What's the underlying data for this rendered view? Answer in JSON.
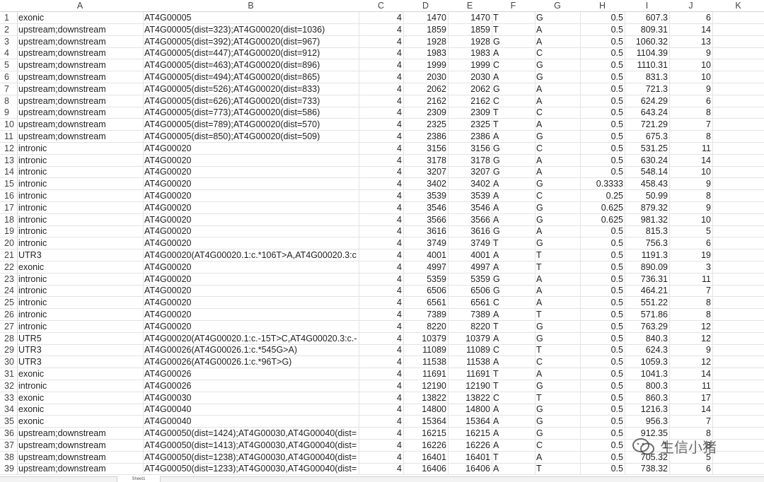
{
  "columns": [
    "A",
    "B",
    "C",
    "D",
    "E",
    "F",
    "G",
    "H",
    "I",
    "J",
    "K"
  ],
  "rows": [
    [
      "1",
      "exonic",
      "AT4G00005",
      "4",
      "1470",
      "1470",
      "T",
      "G",
      "0.5",
      "607.3",
      "6"
    ],
    [
      "2",
      "upstream;downstream",
      "AT4G00005(dist=323);AT4G00020(dist=1036)",
      "4",
      "1859",
      "1859",
      "T",
      "A",
      "0.5",
      "809.31",
      "14"
    ],
    [
      "3",
      "upstream;downstream",
      "AT4G00005(dist=392);AT4G00020(dist=967)",
      "4",
      "1928",
      "1928",
      "G",
      "A",
      "0.5",
      "1060.32",
      "13"
    ],
    [
      "4",
      "upstream;downstream",
      "AT4G00005(dist=447);AT4G00020(dist=912)",
      "4",
      "1983",
      "1983",
      "A",
      "C",
      "0.5",
      "1104.39",
      "9"
    ],
    [
      "5",
      "upstream;downstream",
      "AT4G00005(dist=463);AT4G00020(dist=896)",
      "4",
      "1999",
      "1999",
      "C",
      "G",
      "0.5",
      "1110.31",
      "10"
    ],
    [
      "6",
      "upstream;downstream",
      "AT4G00005(dist=494);AT4G00020(dist=865)",
      "4",
      "2030",
      "2030",
      "A",
      "G",
      "0.5",
      "831.3",
      "10"
    ],
    [
      "7",
      "upstream;downstream",
      "AT4G00005(dist=526);AT4G00020(dist=833)",
      "4",
      "2062",
      "2062",
      "G",
      "A",
      "0.5",
      "721.3",
      "9"
    ],
    [
      "8",
      "upstream;downstream",
      "AT4G00005(dist=626);AT4G00020(dist=733)",
      "4",
      "2162",
      "2162",
      "C",
      "A",
      "0.5",
      "624.29",
      "6"
    ],
    [
      "9",
      "upstream;downstream",
      "AT4G00005(dist=773);AT4G00020(dist=586)",
      "4",
      "2309",
      "2309",
      "T",
      "C",
      "0.5",
      "643.24",
      "8"
    ],
    [
      "10",
      "upstream;downstream",
      "AT4G00005(dist=789);AT4G00020(dist=570)",
      "4",
      "2325",
      "2325",
      "T",
      "A",
      "0.5",
      "721.29",
      "7"
    ],
    [
      "11",
      "upstream;downstream",
      "AT4G00005(dist=850);AT4G00020(dist=509)",
      "4",
      "2386",
      "2386",
      "A",
      "G",
      "0.5",
      "675.3",
      "8"
    ],
    [
      "12",
      "intronic",
      "AT4G00020",
      "4",
      "3156",
      "3156",
      "G",
      "C",
      "0.5",
      "531.25",
      "11"
    ],
    [
      "13",
      "intronic",
      "AT4G00020",
      "4",
      "3178",
      "3178",
      "G",
      "A",
      "0.5",
      "630.24",
      "14"
    ],
    [
      "14",
      "intronic",
      "AT4G00020",
      "4",
      "3207",
      "3207",
      "G",
      "A",
      "0.5",
      "548.14",
      "10"
    ],
    [
      "15",
      "intronic",
      "AT4G00020",
      "4",
      "3402",
      "3402",
      "A",
      "G",
      "0.3333",
      "458.43",
      "9"
    ],
    [
      "16",
      "intronic",
      "AT4G00020",
      "4",
      "3539",
      "3539",
      "A",
      "C",
      "0.25",
      "50.99",
      "8"
    ],
    [
      "17",
      "intronic",
      "AT4G00020",
      "4",
      "3546",
      "3546",
      "A",
      "G",
      "0.625",
      "879.32",
      "9"
    ],
    [
      "18",
      "intronic",
      "AT4G00020",
      "4",
      "3566",
      "3566",
      "A",
      "G",
      "0.625",
      "981.32",
      "10"
    ],
    [
      "19",
      "intronic",
      "AT4G00020",
      "4",
      "3616",
      "3616",
      "G",
      "A",
      "0.5",
      "815.3",
      "5"
    ],
    [
      "20",
      "intronic",
      "AT4G00020",
      "4",
      "3749",
      "3749",
      "T",
      "G",
      "0.5",
      "756.3",
      "6"
    ],
    [
      "21",
      "UTR3",
      "AT4G00020(AT4G00020.1:c.*106T>A,AT4G00020.3:c",
      "4",
      "4001",
      "4001",
      "A",
      "T",
      "0.5",
      "1191.3",
      "19"
    ],
    [
      "22",
      "exonic",
      "AT4G00020",
      "4",
      "4997",
      "4997",
      "A",
      "T",
      "0.5",
      "890.09",
      "3"
    ],
    [
      "23",
      "intronic",
      "AT4G00020",
      "4",
      "5359",
      "5359",
      "G",
      "A",
      "0.5",
      "736.31",
      "11"
    ],
    [
      "24",
      "intronic",
      "AT4G00020",
      "4",
      "6506",
      "6506",
      "G",
      "A",
      "0.5",
      "464.21",
      "7"
    ],
    [
      "25",
      "intronic",
      "AT4G00020",
      "4",
      "6561",
      "6561",
      "C",
      "A",
      "0.5",
      "551.22",
      "8"
    ],
    [
      "26",
      "intronic",
      "AT4G00020",
      "4",
      "7389",
      "7389",
      "A",
      "T",
      "0.5",
      "571.86",
      "8"
    ],
    [
      "27",
      "intronic",
      "AT4G00020",
      "4",
      "8220",
      "8220",
      "T",
      "G",
      "0.5",
      "763.29",
      "12"
    ],
    [
      "28",
      "UTR5",
      "AT4G00020(AT4G00020.1:c.-15T>C,AT4G00020.3:c.-",
      "4",
      "10379",
      "10379",
      "A",
      "G",
      "0.5",
      "840.3",
      "12"
    ],
    [
      "29",
      "UTR3",
      "AT4G00026(AT4G00026.1:c.*545G>A)",
      "4",
      "11089",
      "11089",
      "C",
      "T",
      "0.5",
      "624.3",
      "9"
    ],
    [
      "30",
      "UTR3",
      "AT4G00026(AT4G00026.1:c.*96T>G)",
      "4",
      "11538",
      "11538",
      "A",
      "C",
      "0.5",
      "1059.3",
      "12"
    ],
    [
      "31",
      "exonic",
      "AT4G00026",
      "4",
      "11691",
      "11691",
      "T",
      "A",
      "0.5",
      "1041.3",
      "14"
    ],
    [
      "32",
      "intronic",
      "AT4G00026",
      "4",
      "12190",
      "12190",
      "T",
      "G",
      "0.5",
      "800.3",
      "11"
    ],
    [
      "33",
      "exonic",
      "AT4G00030",
      "4",
      "13822",
      "13822",
      "C",
      "T",
      "0.5",
      "860.3",
      "17"
    ],
    [
      "34",
      "exonic",
      "AT4G00040",
      "4",
      "14800",
      "14800",
      "A",
      "G",
      "0.5",
      "1216.3",
      "14"
    ],
    [
      "35",
      "exonic",
      "AT4G00040",
      "4",
      "15364",
      "15364",
      "A",
      "G",
      "0.5",
      "956.3",
      "7"
    ],
    [
      "36",
      "upstream;downstream",
      "AT4G00050(dist=1424);AT4G00030,AT4G00040(dist=",
      "4",
      "16215",
      "16215",
      "A",
      "G",
      "0.5",
      "912.35",
      "8"
    ],
    [
      "37",
      "upstream;downstream",
      "AT4G00050(dist=1413);AT4G00030,AT4G00040(dist=",
      "4",
      "16226",
      "16226",
      "A",
      "C",
      "0.5",
      "1",
      "8"
    ],
    [
      "38",
      "upstream;downstream",
      "AT4G00050(dist=1238);AT4G00030,AT4G00040(dist=",
      "4",
      "16401",
      "16401",
      "T",
      "A",
      "0.5",
      "705.32",
      "5"
    ],
    [
      "39",
      "upstream;downstream",
      "AT4G00050(dist=1233);AT4G00030,AT4G00040(dist=",
      "4",
      "16406",
      "16406",
      "A",
      "T",
      "0.5",
      "738.32",
      "6"
    ]
  ],
  "sheet_tab": "Sheet1",
  "watermark": "生信小猪",
  "colors": {
    "grid_line": "#e3e3e3",
    "header_bg": "#ffffff",
    "text": "#222222"
  }
}
